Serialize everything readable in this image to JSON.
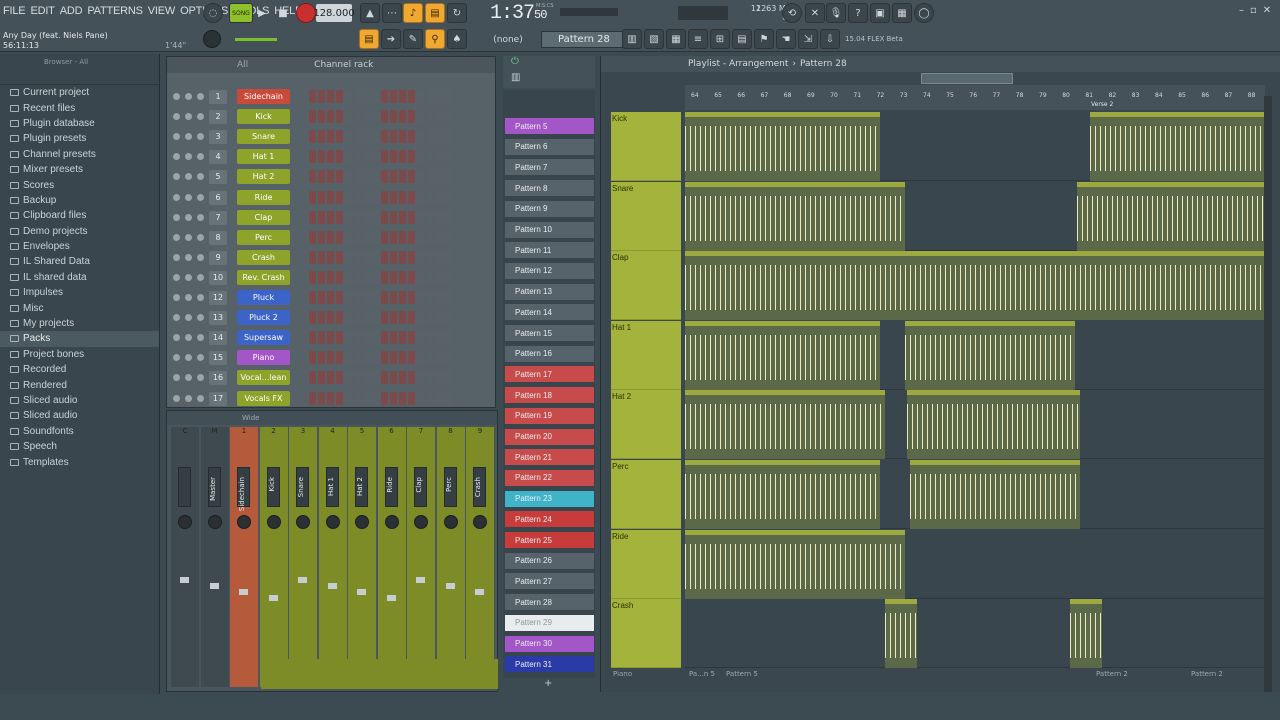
{
  "menu": [
    "FILE",
    "EDIT",
    "ADD",
    "PATTERNS",
    "VIEW",
    "OPTIONS",
    "TOOLS",
    "HELP"
  ],
  "hint": {
    "song": "Any Day (feat. Niels Pane)",
    "time": "56:11:13",
    "pos": "1'44\""
  },
  "transport": {
    "mode": "SONG",
    "tempo": "128.000",
    "clock": "1:37",
    "clock_sub": "50",
    "clock_unit": "M:S:CS",
    "cpu": "12",
    "mem": "1263 MB",
    "voices": "0"
  },
  "toolbar": {
    "snap": "(none)",
    "pattern": "Pattern 28",
    "news": "15.04  FLEX Beta"
  },
  "browser": {
    "title": "Browser - All",
    "items": [
      "Current project",
      "Recent files",
      "Plugin database",
      "Plugin presets",
      "Channel presets",
      "Mixer presets",
      "Scores",
      "Backup",
      "Clipboard files",
      "Demo projects",
      "Envelopes",
      "IL Shared Data",
      "IL shared data",
      "Impulses",
      "Misc",
      "My projects",
      "Packs",
      "Project bones",
      "Recorded",
      "Rendered",
      "Sliced audio",
      "Sliced audio",
      "Soundfonts",
      "Speech",
      "Templates"
    ]
  },
  "rack": {
    "filter": "All",
    "title": "Channel rack",
    "channels": [
      {
        "n": "1",
        "name": "Sidechain",
        "color": "#c84b3a"
      },
      {
        "n": "2",
        "name": "Kick",
        "color": "#8da32a"
      },
      {
        "n": "3",
        "name": "Snare",
        "color": "#8da32a"
      },
      {
        "n": "4",
        "name": "Hat 1",
        "color": "#8da32a"
      },
      {
        "n": "5",
        "name": "Hat 2",
        "color": "#8da32a"
      },
      {
        "n": "6",
        "name": "Ride",
        "color": "#8da32a"
      },
      {
        "n": "7",
        "name": "Clap",
        "color": "#8da32a"
      },
      {
        "n": "8",
        "name": "Perc",
        "color": "#8da32a"
      },
      {
        "n": "9",
        "name": "Crash",
        "color": "#8da32a"
      },
      {
        "n": "10",
        "name": "Rev. Crash",
        "color": "#8da32a"
      },
      {
        "n": "12",
        "name": "Pluck",
        "color": "#3b63c8"
      },
      {
        "n": "13",
        "name": "Pluck 2",
        "color": "#3b63c8"
      },
      {
        "n": "14",
        "name": "Supersaw",
        "color": "#3b63c8"
      },
      {
        "n": "15",
        "name": "Piano",
        "color": "#a356c7"
      },
      {
        "n": "16",
        "name": "Vocal...lean",
        "color": "#8da32a"
      },
      {
        "n": "17",
        "name": "Vocals FX",
        "color": "#8da32a"
      }
    ]
  },
  "mixer": {
    "view": "Wide",
    "strips": [
      {
        "n": "C",
        "label": "",
        "type": "d"
      },
      {
        "n": "M",
        "label": "Master",
        "type": "d"
      },
      {
        "n": "1",
        "label": "Sidechain",
        "type": "r"
      },
      {
        "n": "2",
        "label": "Kick",
        "type": "g"
      },
      {
        "n": "3",
        "label": "Snare",
        "type": "g"
      },
      {
        "n": "4",
        "label": "Hat 1",
        "type": "g"
      },
      {
        "n": "5",
        "label": "Hat 2",
        "type": "g"
      },
      {
        "n": "6",
        "label": "Ride",
        "type": "g"
      },
      {
        "n": "7",
        "label": "Clap",
        "type": "g"
      },
      {
        "n": "8",
        "label": "Perc",
        "type": "g"
      },
      {
        "n": "9",
        "label": "Crash",
        "type": "g"
      }
    ]
  },
  "patterns": [
    {
      "name": "Pattern 5",
      "color": "#a356c7"
    },
    {
      "name": "Pattern 6",
      "color": "#56636a"
    },
    {
      "name": "Pattern 7",
      "color": "#56636a"
    },
    {
      "name": "Pattern 8",
      "color": "#56636a"
    },
    {
      "name": "Pattern 9",
      "color": "#56636a"
    },
    {
      "name": "Pattern 10",
      "color": "#56636a"
    },
    {
      "name": "Pattern 11",
      "color": "#56636a"
    },
    {
      "name": "Pattern 12",
      "color": "#56636a"
    },
    {
      "name": "Pattern 13",
      "color": "#56636a"
    },
    {
      "name": "Pattern 14",
      "color": "#56636a"
    },
    {
      "name": "Pattern 15",
      "color": "#56636a"
    },
    {
      "name": "Pattern 16",
      "color": "#56636a"
    },
    {
      "name": "Pattern 17",
      "color": "#c84b4b"
    },
    {
      "name": "Pattern 18",
      "color": "#c84b4b"
    },
    {
      "name": "Pattern 19",
      "color": "#c84b4b"
    },
    {
      "name": "Pattern 20",
      "color": "#c84b4b"
    },
    {
      "name": "Pattern 21",
      "color": "#c84b4b"
    },
    {
      "name": "Pattern 22",
      "color": "#c84b4b"
    },
    {
      "name": "Pattern 23",
      "color": "#3fb4c8"
    },
    {
      "name": "Pattern 24",
      "color": "#c83b3b"
    },
    {
      "name": "Pattern 25",
      "color": "#c83b3b"
    },
    {
      "name": "Pattern 26",
      "color": "#56636a"
    },
    {
      "name": "Pattern 27",
      "color": "#56636a"
    },
    {
      "name": "Pattern 28",
      "color": "#56636a"
    },
    {
      "name": "Pattern 29",
      "color": "#e8ecee"
    },
    {
      "name": "Pattern 30",
      "color": "#a356c7"
    },
    {
      "name": "Pattern 31",
      "color": "#2a3ba8"
    }
  ],
  "playlist": {
    "title": "Playlist - Arrangement",
    "pattern": "Pattern 28",
    "marker": "Verse 2",
    "bars": [
      "64",
      "65",
      "66",
      "67",
      "68",
      "69",
      "70",
      "71",
      "72",
      "73",
      "74",
      "75",
      "76",
      "77",
      "78",
      "79",
      "80",
      "81",
      "82",
      "83",
      "84",
      "85",
      "86",
      "87",
      "88"
    ],
    "tracks": [
      "Kick",
      "Snare",
      "Clap",
      "Hat 1",
      "Hat 2",
      "Perc",
      "Ride",
      "Crash"
    ],
    "footer": [
      "Piano",
      "Pa...n 5",
      "Pattern 5",
      "Pattern 2",
      "Pattern 2"
    ]
  },
  "colors": {
    "accent": "#f0a830",
    "track": "#a4b33b"
  }
}
